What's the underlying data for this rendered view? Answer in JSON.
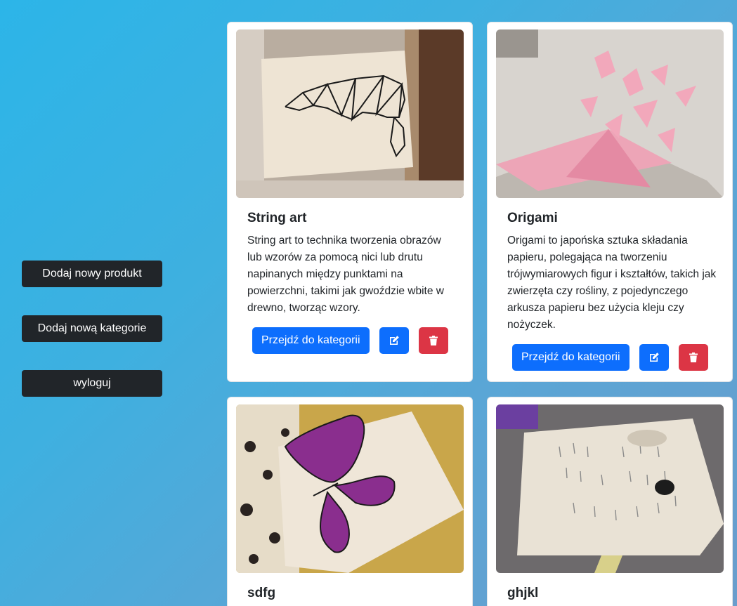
{
  "sidebar": {
    "add_product": "Dodaj nowy produkt",
    "add_category": "Dodaj nową kategorie",
    "logout": "wyloguj"
  },
  "cards": [
    {
      "title": "String art",
      "description": "String art to technika tworzenia obrazów lub wzorów za pomocą nici lub drutu napinanych między punktami na powierzchni, takimi jak gwoździe wbite w drewno, tworząc wzory.",
      "goto_label": "Przejdź do kategorii"
    },
    {
      "title": "Origami",
      "description": "Origami to japońska sztuka składania papieru, polegająca na tworzeniu trójwymiarowych figur i kształtów, takich jak zwierzęta czy rośliny, z pojedynczego arkusza papieru bez użycia kleju czy nożyczek.",
      "goto_label": "Przejdź do kategorii"
    },
    {
      "title": "sdfg"
    },
    {
      "title": "ghjkl"
    }
  ],
  "icons": {
    "edit": "edit-icon",
    "delete": "trash-icon"
  },
  "colors": {
    "primary": "#0d6efd",
    "danger": "#dc3545",
    "dark": "#212529"
  }
}
